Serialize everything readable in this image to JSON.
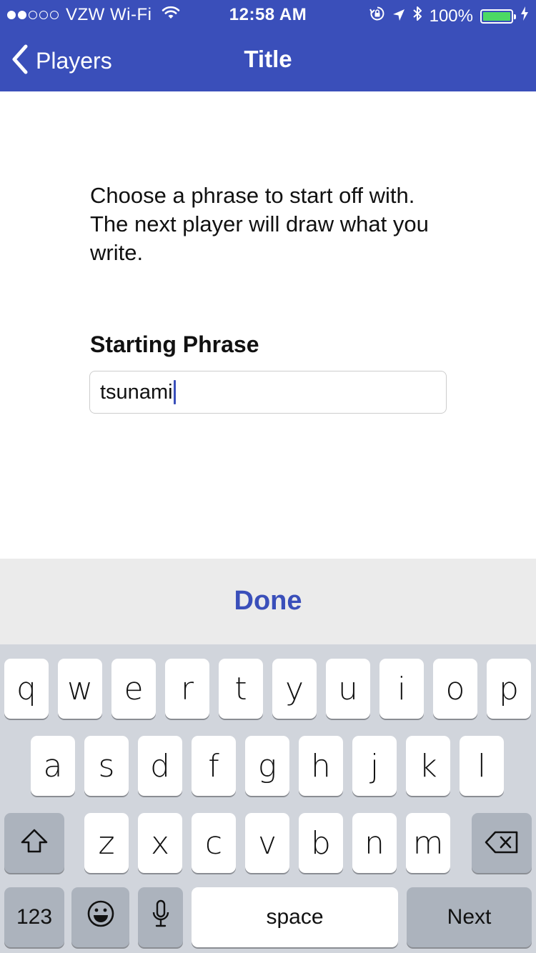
{
  "status_bar": {
    "carrier": "VZW Wi-Fi",
    "time": "12:58 AM",
    "battery_percent": "100%",
    "signal_bars_filled": 2,
    "signal_bars_total": 5,
    "icons": [
      "wifi-icon",
      "rotation-lock-icon",
      "location-arrow-icon",
      "bluetooth-icon",
      "battery-icon",
      "charging-bolt-icon"
    ]
  },
  "nav": {
    "back_label": "Players",
    "title": "Title"
  },
  "content": {
    "instruction": "Choose a phrase to start off with. The next player will draw what you write.",
    "field_label": "Starting Phrase",
    "input_value": "tsunami"
  },
  "accessory": {
    "done_label": "Done"
  },
  "keyboard": {
    "row1": [
      "q",
      "w",
      "e",
      "r",
      "t",
      "y",
      "u",
      "i",
      "o",
      "p"
    ],
    "row2": [
      "a",
      "s",
      "d",
      "f",
      "g",
      "h",
      "j",
      "k",
      "l"
    ],
    "row3": [
      "z",
      "x",
      "c",
      "v",
      "b",
      "n",
      "m"
    ],
    "numbers_label": "123",
    "space_label": "space",
    "next_label": "Next"
  },
  "colors": {
    "accent": "#3a4fba",
    "battery_green": "#4cd964",
    "keyboard_bg": "#d1d5dc",
    "accessory_bg": "#ebebeb"
  }
}
